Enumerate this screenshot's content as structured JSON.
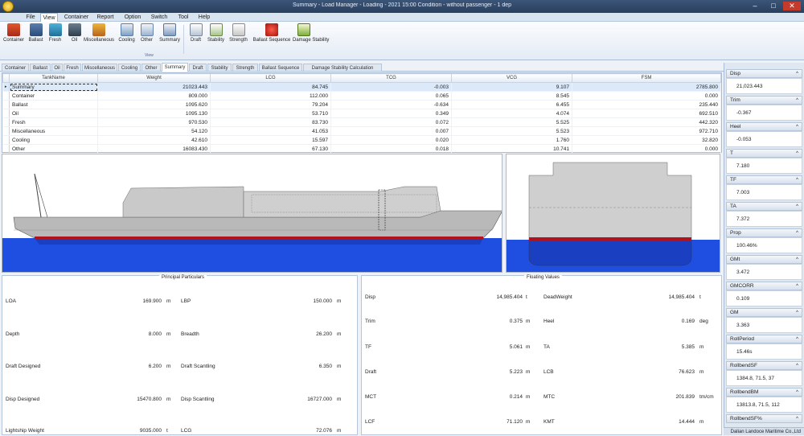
{
  "window": {
    "title": "Summary - Load Manager - Loading - 2021 15:00 Condition - without passenger - 1 dep",
    "minimize": "–",
    "maximize": "□",
    "close": "✕"
  },
  "menu": [
    "File",
    "View",
    "Container",
    "Report",
    "Option",
    "Switch",
    "Tool",
    "Help"
  ],
  "ribbon": {
    "buttons": [
      "Container",
      "Ballast",
      "Fresh",
      "Oil",
      "Miscellaneous",
      "Cooling",
      "Other",
      "Summary",
      "Draft",
      "Stability",
      "Strength",
      "Ballast Sequence",
      "Damage Stability"
    ],
    "group_label": "View"
  },
  "tabs": [
    "Container",
    "Ballast",
    "Oil",
    "Fresh",
    "Miscellaneous",
    "Cooling",
    "Other",
    "Summary",
    "Draft",
    "Stability",
    "Strength",
    "Ballast Sequence",
    "Damage Stability Calculation"
  ],
  "active_tab": "Summary",
  "grid": {
    "columns": [
      "TankName",
      "Weight",
      "LCG",
      "TCG",
      "VCG",
      "FSM"
    ],
    "rows": [
      [
        "Summary",
        "21023.443",
        "84.745",
        "-0.003",
        "9.107",
        "2785.800"
      ],
      [
        "Container",
        "809.000",
        "112.000",
        "0.065",
        "8.545",
        "0.000"
      ],
      [
        "Ballast",
        "1095.620",
        "79.204",
        "-0.634",
        "6.455",
        "235.440"
      ],
      [
        "Oil",
        "1095.130",
        "53.710",
        "0.349",
        "4.074",
        "692.510"
      ],
      [
        "Fresh",
        "970.530",
        "83.730",
        "0.072",
        "5.525",
        "442.320"
      ],
      [
        "Miscellaneous",
        "54.120",
        "41.053",
        "0.007",
        "5.523",
        "972.710"
      ],
      [
        "Cooling",
        "42.610",
        "15.597",
        "0.020",
        "1.760",
        "32.820"
      ],
      [
        "Other",
        "16083.430",
        "67.130",
        "0.018",
        "10.741",
        "0.000"
      ]
    ]
  },
  "principal": {
    "title": "Principal Particulars",
    "items": [
      {
        "label": "LOA",
        "value": "169.900",
        "unit": "m"
      },
      {
        "label": "LBP",
        "value": "150.000",
        "unit": "m"
      },
      {
        "label": "Depth",
        "value": "8.000",
        "unit": "m"
      },
      {
        "label": "Breadth",
        "value": "26.200",
        "unit": "m"
      },
      {
        "label": "Draft Designed",
        "value": "6.200",
        "unit": "m"
      },
      {
        "label": "Draft Scantling",
        "value": "6.350",
        "unit": "m"
      },
      {
        "label": "Disp Designed",
        "value": "15470.800",
        "unit": "m"
      },
      {
        "label": "Disp Scantling",
        "value": "16727.000",
        "unit": "m"
      },
      {
        "label": "Lightship Weight",
        "value": "9035.000",
        "unit": "t"
      },
      {
        "label": "LCG",
        "value": "72.076",
        "unit": "m"
      }
    ]
  },
  "floating": {
    "title": "Floating Values",
    "items": [
      {
        "label": "Disp",
        "value": "14,985.404",
        "unit": "t"
      },
      {
        "label": "DeadWeight",
        "value": "14,985.404",
        "unit": "t"
      },
      {
        "label": "Trim",
        "value": "0.375",
        "unit": "m"
      },
      {
        "label": "Heel",
        "value": "0.169",
        "unit": "deg"
      },
      {
        "label": "TF",
        "value": "5.061",
        "unit": "m"
      },
      {
        "label": "TA",
        "value": "5.385",
        "unit": "m"
      },
      {
        "label": "Draft",
        "value": "5.223",
        "unit": "m"
      },
      {
        "label": "LCB",
        "value": "76.623",
        "unit": "m"
      },
      {
        "label": "MCT",
        "value": "0.214",
        "unit": "m"
      },
      {
        "label": "MTC",
        "value": "201.839",
        "unit": "tm/cm"
      },
      {
        "label": "LCF",
        "value": "71.120",
        "unit": "m"
      },
      {
        "label": "KMT",
        "value": "14.444",
        "unit": "m"
      }
    ]
  },
  "right_panel": [
    {
      "label": "Disp",
      "value": "21,023.443"
    },
    {
      "label": "Trim",
      "value": "-0.367"
    },
    {
      "label": "Heel",
      "value": "-0.053"
    },
    {
      "label": "T",
      "value": "7.180"
    },
    {
      "label": "TF",
      "value": "7.003"
    },
    {
      "label": "TA",
      "value": "7.372"
    },
    {
      "label": "Prop",
      "value": "100.46%"
    },
    {
      "label": "GMt",
      "value": "3.472"
    },
    {
      "label": "GMCORR",
      "value": "0.109"
    },
    {
      "label": "GM",
      "value": "3.363"
    },
    {
      "label": "RollPeriod",
      "value": "15.46s"
    },
    {
      "label": "RollbendSF",
      "value": "1384.8, 71.5, 37"
    },
    {
      "label": "RollbendBM",
      "value": "13813.8, 71.5, 112"
    },
    {
      "label": "RollbendSF%",
      "value": ""
    }
  ],
  "status": "Dalian Landoce Maritime Co.,Ltd",
  "colors": {
    "sea": "#1f4fe0",
    "hull_gray": "#b9b9b9",
    "boot_red": "#b0131e",
    "accent": "#2a3f5e"
  }
}
